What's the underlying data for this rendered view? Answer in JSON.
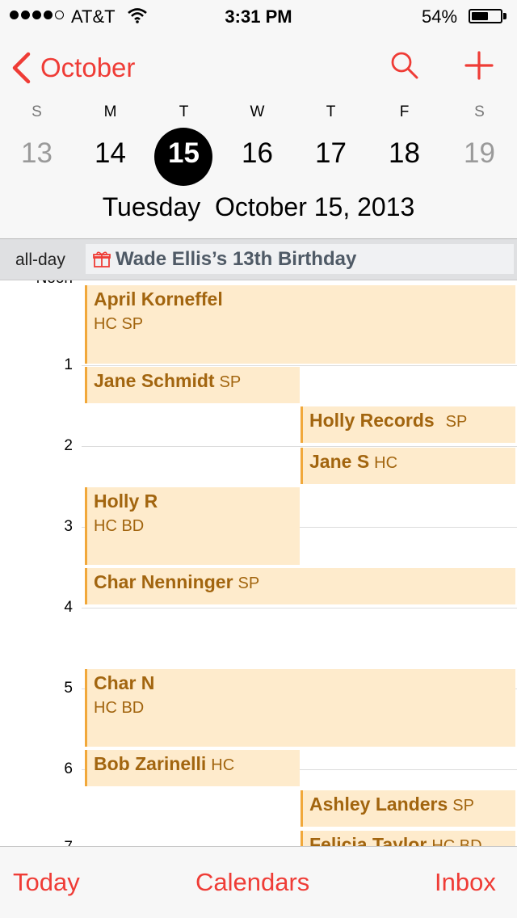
{
  "status_bar": {
    "carrier": "AT&T",
    "time": "3:31 PM",
    "battery_percent": "54%",
    "battery_level": 0.54,
    "signal_bars": 4,
    "signal_max": 5
  },
  "nav": {
    "back_label": "October",
    "search_icon": "search-icon",
    "add_icon": "plus-icon",
    "accent_color": "#ef3c36"
  },
  "week": {
    "days": [
      {
        "letter": "S",
        "number": "13"
      },
      {
        "letter": "M",
        "number": "14"
      },
      {
        "letter": "T",
        "number": "15"
      },
      {
        "letter": "W",
        "number": "16"
      },
      {
        "letter": "T",
        "number": "17"
      },
      {
        "letter": "F",
        "number": "18"
      },
      {
        "letter": "S",
        "number": "19"
      }
    ],
    "selected_index": 2,
    "full_date": "Tuesday  October 15, 2013"
  },
  "all_day": {
    "label": "all-day",
    "event_title": "Wade Ellis’s 13th Birthday",
    "event_icon": "gift-icon"
  },
  "timeline": {
    "hours": [
      "Noon",
      "1",
      "2",
      "3",
      "4",
      "5",
      "6",
      "7"
    ],
    "events": [
      {
        "title": "April Korneffel",
        "tags": "HC SP"
      },
      {
        "title": "Jane Schmidt",
        "tags": "SP"
      },
      {
        "title": "Holly Records",
        "tags": "SP"
      },
      {
        "title": "Jane S",
        "tags": "HC"
      },
      {
        "title": "Holly R",
        "tags": "HC BD"
      },
      {
        "title": "Char Nenninger",
        "tags": "SP"
      },
      {
        "title": "Char N",
        "tags": "HC BD"
      },
      {
        "title": "Bob Zarinelli",
        "tags": "HC"
      },
      {
        "title": "Ashley Landers",
        "tags": "SP"
      },
      {
        "title": "Felicia Taylor",
        "tags": "HC BD"
      }
    ],
    "event_color": "#feebcc",
    "event_border_color": "#f1a83a",
    "event_text_color": "#a2650f"
  },
  "tab_bar": {
    "today": "Today",
    "calendars": "Calendars",
    "inbox": "Inbox"
  }
}
